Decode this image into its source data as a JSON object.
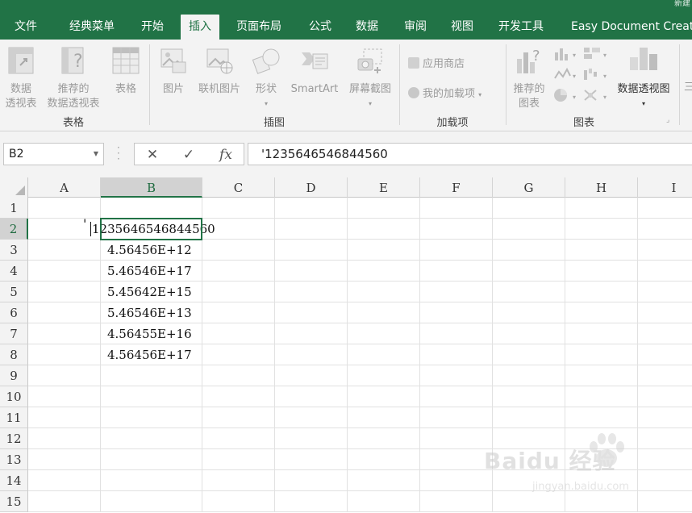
{
  "window": {
    "title_fragment": "新建"
  },
  "tabs": [
    {
      "label": "文件"
    },
    {
      "label": "经典菜单"
    },
    {
      "label": "开始"
    },
    {
      "label": "插入"
    },
    {
      "label": "页面布局"
    },
    {
      "label": "公式"
    },
    {
      "label": "数据"
    },
    {
      "label": "审阅"
    },
    {
      "label": "视图"
    },
    {
      "label": "开发工具"
    },
    {
      "label": "Easy Document Creat"
    }
  ],
  "active_tab": "插入",
  "ribbon": {
    "groups": {
      "tables": "表格",
      "illustrations": "插图",
      "addins": "加载项",
      "charts": "图表"
    },
    "buttons": {
      "pivot_table_l1": "数据",
      "pivot_table_l2": "透视表",
      "recommended_pivot_l1": "推荐的",
      "recommended_pivot_l2": "数据透视表",
      "table": "表格",
      "pictures": "图片",
      "online_pictures": "联机图片",
      "shapes": "形状",
      "smartart": "SmartArt",
      "screenshot": "屏幕截图",
      "store": "应用商店",
      "my_addins": "我的加载项",
      "recommended_charts_l1": "推荐的",
      "recommended_charts_l2": "图表",
      "pivot_chart": "数据透视图",
      "partial_next": "三"
    }
  },
  "formula_bar": {
    "name_box": "B2",
    "cancel_symbol": "✕",
    "enter_symbol": "✓",
    "fx_symbol": "fx",
    "formula": "'1235646546844560"
  },
  "sheet": {
    "columns": [
      "A",
      "B",
      "C",
      "D",
      "E",
      "F",
      "G",
      "H",
      "I"
    ],
    "rows": [
      "1",
      "2",
      "3",
      "4",
      "5",
      "6",
      "7",
      "8",
      "9",
      "10",
      "11",
      "12",
      "13",
      "14",
      "15"
    ],
    "selected_cell": "B2",
    "b2_apostrophe": "'",
    "b2_text": "1235646546844560",
    "column_b_values": [
      "4.56456E+12",
      "5.46546E+17",
      "5.45642E+15",
      "5.46546E+13",
      "4.56455E+16",
      "4.56456E+17"
    ]
  },
  "watermark": {
    "text": "Baidu 经验",
    "sub": "jingyan.baidu.com"
  },
  "colors": {
    "accent": "#217346",
    "ribbon_bg": "#f3f3f3",
    "header_sel": "#d2d2d2"
  }
}
